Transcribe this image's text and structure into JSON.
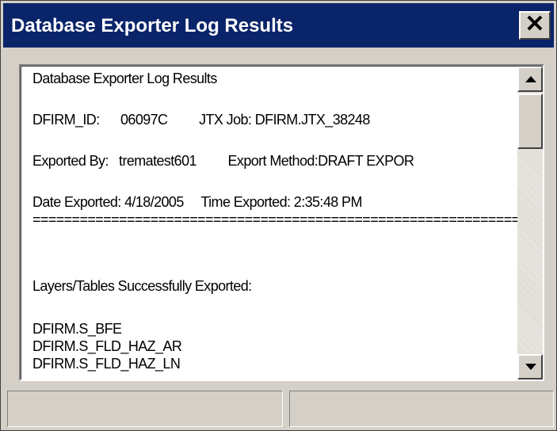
{
  "window": {
    "title": "Database Exporter Log Results",
    "close_label": "✕"
  },
  "log": {
    "lines": [
      "Database Exporter Log Results",
      "DFIRM_ID:      06097C         JTX Job: DFIRM.JTX_38248",
      "Exported By:   trematest601         Export Method:DRAFT EXPOR",
      "Date Exported: 4/18/2005     Time Exported: 2:35:48 PM",
      "================================================================",
      "Layers/Tables Successfully Exported:",
      "DFIRM.S_BFE",
      "DFIRM.S_FLD_HAZ_AR",
      "DFIRM.S_FLD_HAZ_LN"
    ]
  },
  "status_bar": {
    "pane_1": "",
    "pane_2": ""
  }
}
